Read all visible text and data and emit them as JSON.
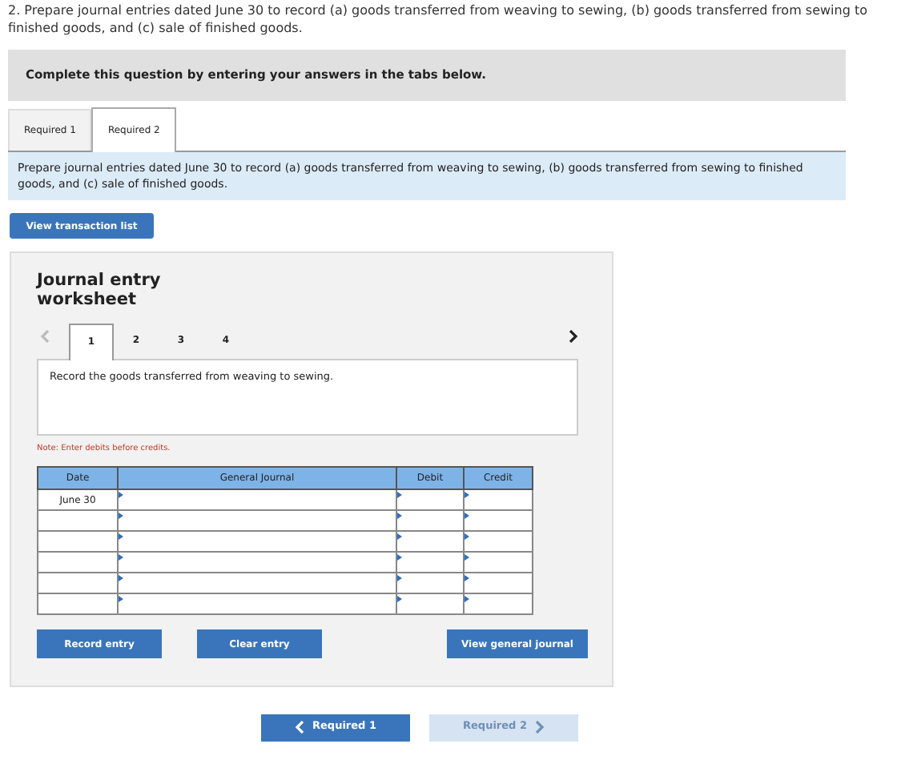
{
  "question": "2. Prepare journal entries dated June 30 to record (a) goods transferred from weaving to sewing, (b) goods transferred from sewing to finished goods, and (c) sale of finished goods.",
  "instruction": "Complete this question by entering your answers in the tabs below.",
  "tabs": [
    {
      "label": "Required 1",
      "selected": false
    },
    {
      "label": "Required 2",
      "selected": true
    }
  ],
  "description": "Prepare journal entries dated June 30 to record (a) goods transferred from weaving to sewing, (b) goods transferred from sewing to finished goods, and (c) sale of finished goods.",
  "transaction_button": "View transaction list",
  "worksheet": {
    "title": "Journal entry worksheet",
    "prev_disabled": true,
    "entries": [
      {
        "label": "1",
        "selected": true
      },
      {
        "label": "2",
        "selected": false
      },
      {
        "label": "3",
        "selected": false
      },
      {
        "label": "4",
        "selected": false
      }
    ],
    "prompt": "Record the goods transferred from weaving to sewing.",
    "note": "Note: Enter debits before credits.",
    "columns": [
      "Date",
      "General Journal",
      "Debit",
      "Credit"
    ],
    "rows": [
      {
        "date": "June 30"
      },
      {
        "date": ""
      },
      {
        "date": ""
      },
      {
        "date": ""
      },
      {
        "date": ""
      },
      {
        "date": ""
      }
    ],
    "buttons": [
      "Record entry",
      "Clear entry",
      "View general journal"
    ]
  },
  "nav": [
    {
      "label": "Required 1",
      "kind": "prev",
      "disabled": false
    },
    {
      "label": "Required 2",
      "kind": "next",
      "disabled": true
    }
  ]
}
